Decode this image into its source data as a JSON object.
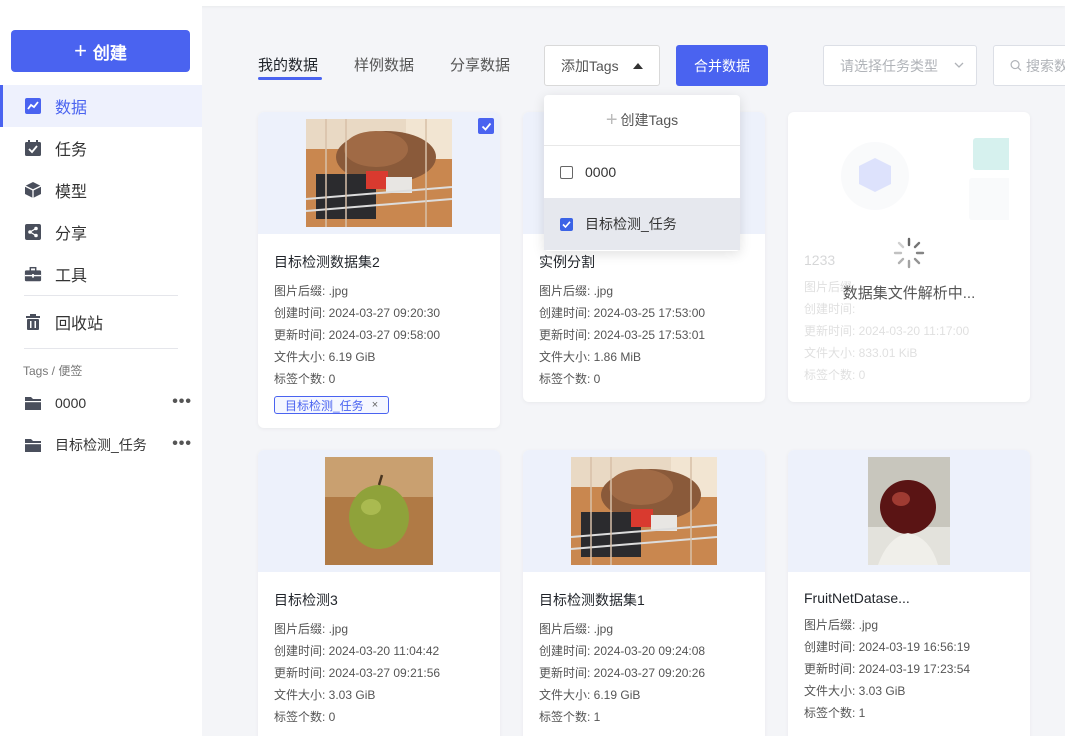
{
  "sidebar": {
    "create_label": "创建",
    "nav": [
      {
        "label": "数据",
        "icon": "chart-icon",
        "active": true
      },
      {
        "label": "任务",
        "icon": "calendar-check-icon"
      },
      {
        "label": "模型",
        "icon": "cube-icon"
      },
      {
        "label": "分享",
        "icon": "share-icon"
      },
      {
        "label": "工具",
        "icon": "toolbox-icon"
      },
      {
        "label": "回收站",
        "icon": "trash-icon"
      }
    ],
    "tags_title": "Tags / 便签",
    "tags": [
      {
        "label": "0000",
        "more": "•••"
      },
      {
        "label": "目标检测_任务",
        "more": "•••"
      }
    ]
  },
  "toolbar": {
    "tabs": [
      "我的数据",
      "样例数据",
      "分享数据"
    ],
    "add_tags_label": "添加Tags",
    "merge_label": "合并数据",
    "task_type_placeholder": "请选择任务类型",
    "search_placeholder": "搜索数据"
  },
  "dropdown": {
    "create_label": "创建Tags",
    "options": [
      {
        "label": "0000",
        "checked": false
      },
      {
        "label": "目标检测_任务",
        "checked": true
      }
    ]
  },
  "cards": [
    {
      "name": "目标检测数据集2",
      "suffix": "图片后缀: .jpg",
      "created": "创建时间: 2024-03-27 09:20:30",
      "updated": "更新时间: 2024-03-27 09:58:00",
      "size": "文件大小: 6.19 GiB",
      "labels": "标签个数: 0",
      "tag": "目标检测_任务",
      "tag_close": "×",
      "checked": true,
      "thumb": "dog-basket"
    },
    {
      "name": "实例分割",
      "suffix": "图片后缀: .jpg",
      "created": "创建时间: 2024-03-25 17:53:00",
      "updated": "更新时间: 2024-03-25 17:53:01",
      "size": "文件大小: 1.86 MiB",
      "labels": "标签个数: 0"
    },
    {
      "name": "1233",
      "suffix": "图片后缀:",
      "created": "创建时间:",
      "updated": "更新时间: 2024-03-20 11:17:00",
      "size": "文件大小: 833.01 KiB",
      "labels": "标签个数: 0",
      "loading_text": "数据集文件解析中..."
    },
    {
      "name": "目标检测3",
      "suffix": "图片后缀: .jpg",
      "created": "创建时间: 2024-03-20 11:04:42",
      "updated": "更新时间: 2024-03-27 09:21:56",
      "size": "文件大小: 3.03 GiB",
      "labels": "标签个数: 0",
      "thumb": "green-apple"
    },
    {
      "name": "目标检测数据集1",
      "suffix": "图片后缀: .jpg",
      "created": "创建时间: 2024-03-20 09:24:08",
      "updated": "更新时间: 2024-03-27 09:20:26",
      "size": "文件大小: 6.19 GiB",
      "labels": "标签个数: 1",
      "thumb": "dog-basket"
    },
    {
      "name": "FruitNetDatase...",
      "suffix": "图片后缀: .jpg",
      "created": "创建时间: 2024-03-19 16:56:19",
      "updated": "更新时间: 2024-03-19 17:23:54",
      "size": "文件大小: 3.03 GiB",
      "labels": "标签个数: 1",
      "thumb": "red-apple"
    }
  ],
  "colors": {
    "accent": "#4a63f0",
    "card_thumb_bg": "#edf1fb"
  }
}
